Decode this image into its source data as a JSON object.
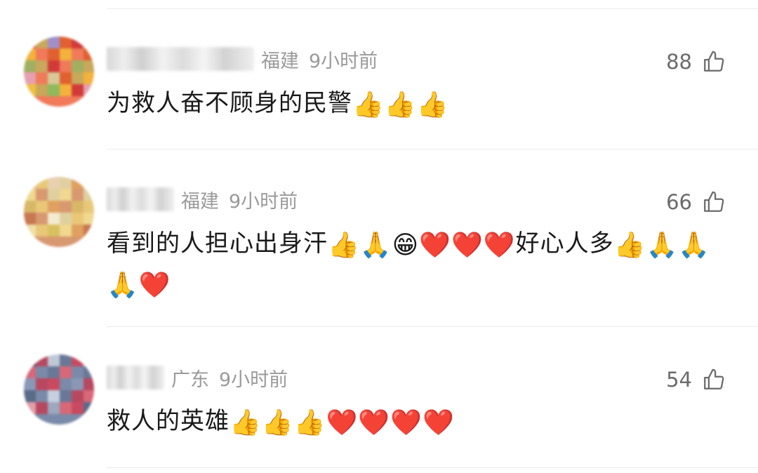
{
  "comments": [
    {
      "location": "福建",
      "time": "9小时前",
      "likes": "88",
      "text": "为救人奋不顾身的民警",
      "emoji_suffix": "👍👍👍",
      "avatar_palette": [
        "#e24a4a",
        "#f07a5a",
        "#a08fc8",
        "#e7a0b0",
        "#d23a3a",
        "#f3b23b",
        "#8fba5c",
        "#c8a85a",
        "#f0c040",
        "#e06030",
        "#a0b060",
        "#d8c898"
      ]
    },
    {
      "location": "福建",
      "time": "9小时前",
      "likes": "66",
      "text": "看到的人担心出身汗",
      "emoji_mid": "👍🙏😁❤️❤️❤️",
      "text_2": "好心人多",
      "emoji_suffix": "👍🙏🙏🙏❤️",
      "avatar_palette": [
        "#e8b8a0",
        "#d89870",
        "#e8d0b0",
        "#c87850",
        "#e0a060",
        "#f0d890",
        "#d8c060",
        "#e8c878",
        "#f0e0a8",
        "#e0d0a0",
        "#d8b868",
        "#f4ead0"
      ]
    },
    {
      "location": "广东",
      "time": "9小时前",
      "likes": "54",
      "text": "救人的英雄",
      "emoji_suffix": "👍👍👍❤️❤️❤️❤️",
      "avatar_palette": [
        "#3a4a68",
        "#7a8aa8",
        "#c0c8d8",
        "#5a6a88",
        "#c84a60",
        "#d86878",
        "#9aa8c0",
        "#b84860",
        "#e0a0a8",
        "#6a7898",
        "#8a98b8",
        "#c8d0e0"
      ]
    }
  ]
}
